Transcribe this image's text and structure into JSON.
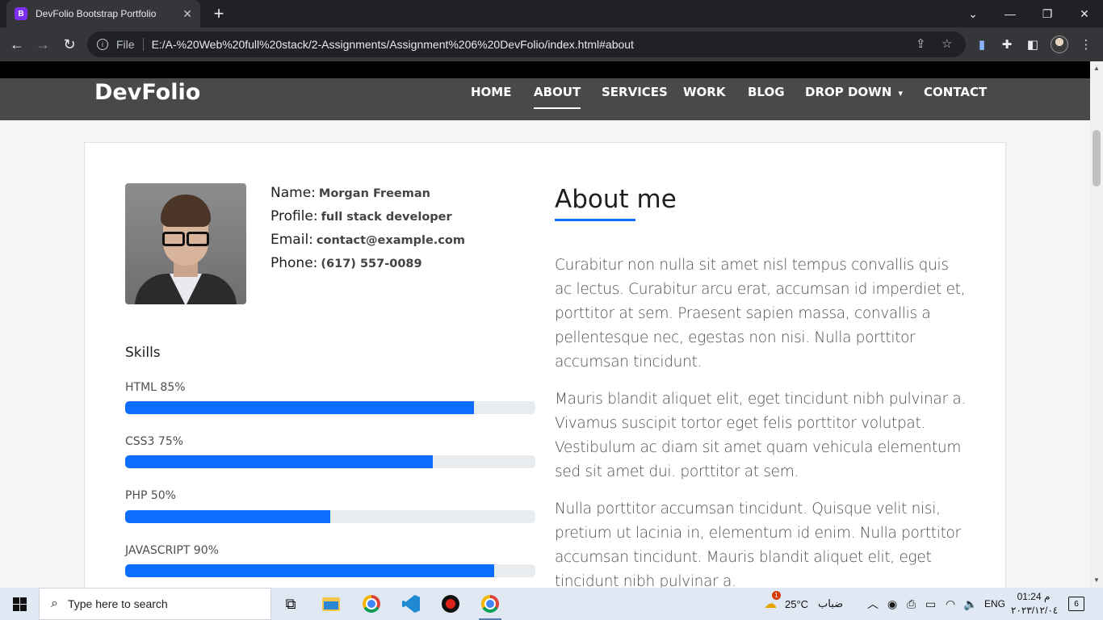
{
  "browser": {
    "tab_title": "DevFolio Bootstrap Portfolio",
    "favicon_letter": "B",
    "address_scheme": "File",
    "address_url": "E:/A-%20Web%20full%20stack/2-Assignments/Assignment%206%20DevFolio/index.html#about"
  },
  "site": {
    "brand": "DevFolio",
    "menu": [
      "HOME",
      "ABOUT",
      "SERVICES",
      "WORK",
      "BLOG",
      "DROP DOWN",
      "CONTACT"
    ],
    "dropdown_caret": "▾"
  },
  "profile": {
    "name_label": "Name:",
    "name": "Morgan Freeman",
    "profile_label": "Profile:",
    "profile": "full stack developer",
    "email_label": "Email:",
    "email": "contact@example.com",
    "phone_label": "Phone:",
    "phone": "(617) 557-0089"
  },
  "skills": {
    "title": "Skills",
    "items": [
      {
        "label": "HTML 85%",
        "percent": 85
      },
      {
        "label": "CSS3 75%",
        "percent": 75
      },
      {
        "label": "PHP 50%",
        "percent": 50
      },
      {
        "label": "JAVASCRIPT 90%",
        "percent": 90
      }
    ]
  },
  "about": {
    "title": "About me",
    "paragraphs": [
      "Curabitur non nulla sit amet nisl tempus convallis quis ac lectus. Curabitur arcu erat, accumsan id imperdiet et, porttitor at sem. Praesent sapien massa, convallis a pellentesque nec, egestas non nisi. Nulla porttitor accumsan tincidunt.",
      "Mauris blandit aliquet elit, eget tincidunt nibh pulvinar a. Vivamus suscipit tortor eget felis porttitor volutpat. Vestibulum ac diam sit amet quam vehicula elementum sed sit amet dui. porttitor at sem.",
      "Nulla porttitor accumsan tincidunt. Quisque velit nisi, pretium ut lacinia in, elementum id enim. Nulla porttitor accumsan tincidunt. Mauris blandit aliquet elit, eget tincidunt nibh pulvinar a."
    ]
  },
  "taskbar": {
    "search_placeholder": "Type here to search",
    "weather_temp": "25°C",
    "weather_text": "ضباب",
    "language": "ENG",
    "time": "01:24 م",
    "date": "٢٠٢٣/١٢/٠٤",
    "notification_count": "6",
    "weather_badge": "1"
  },
  "colors": {
    "accent": "#0d6efd",
    "nav_bg": "#4a4849",
    "chrome_dark": "#202124",
    "chrome_toolbar": "#35363a"
  }
}
